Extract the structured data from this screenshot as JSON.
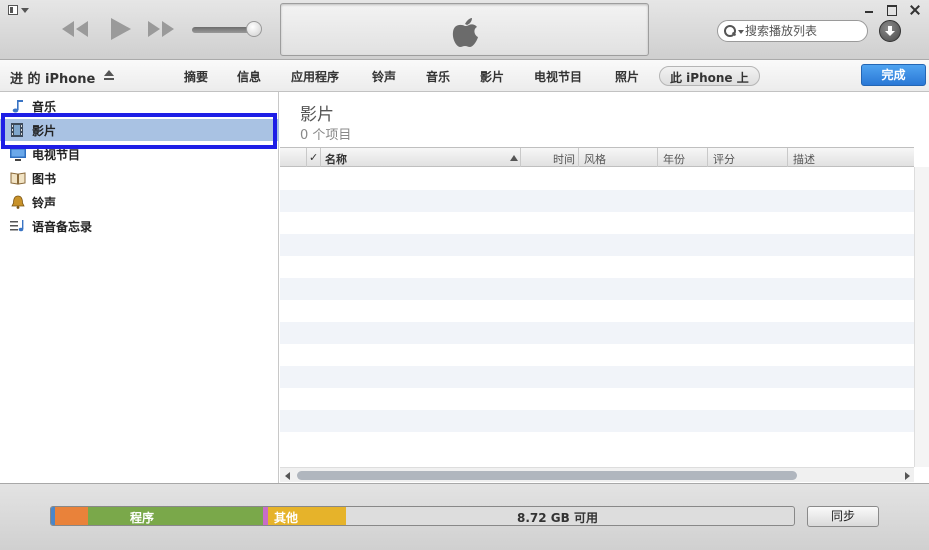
{
  "toolbar": {
    "search_placeholder": "搜索播放列表",
    "icons": [
      "window-menu-icon",
      "rewind-icon",
      "play-icon",
      "fast-forward-icon",
      "volume-slider",
      "apple-logo-icon",
      "search-icon",
      "download-icon",
      "minimize-icon",
      "maximize-icon",
      "close-icon"
    ],
    "volume_level": 0.85
  },
  "device_bar": {
    "device_name": "进 的 iPhone",
    "tabs": [
      "摘要",
      "信息",
      "应用程序",
      "铃声",
      "音乐",
      "影片",
      "电视节目",
      "照片"
    ],
    "on_device_tab": "此 iPhone 上",
    "done_label": "完成",
    "done_color": "#2a78d6"
  },
  "sidebar": {
    "items": [
      {
        "label": "音乐",
        "icon": "music-note-icon"
      },
      {
        "label": "影片",
        "icon": "film-icon",
        "selected": true
      },
      {
        "label": "电视节目",
        "icon": "tv-icon"
      },
      {
        "label": "图书",
        "icon": "book-icon"
      },
      {
        "label": "铃声",
        "icon": "bell-icon"
      },
      {
        "label": "语音备忘录",
        "icon": "voice-memo-icon"
      }
    ],
    "selection_color": "#a9c2e3",
    "highlight_box_color": "#1e1ee6"
  },
  "content": {
    "title": "影片",
    "subtitle": "0 个项目",
    "columns": [
      "✓",
      "名称",
      "时间",
      "风格",
      "年份",
      "评分",
      "描述"
    ],
    "rows": []
  },
  "capacity": {
    "segments": [
      {
        "name": "",
        "color": "#4a86c8",
        "fraction": 0.006
      },
      {
        "name": "",
        "color": "#e9823a",
        "fraction": 0.045
      },
      {
        "name": "程序",
        "color": "#7aa84a",
        "fraction": 0.235
      },
      {
        "name": "",
        "color": "#c86cc8",
        "fraction": 0.007
      },
      {
        "name": "其他",
        "color": "#e6b32a",
        "fraction": 0.105
      }
    ],
    "free_label": "8.72 GB 可用",
    "sync_label": "同步"
  }
}
